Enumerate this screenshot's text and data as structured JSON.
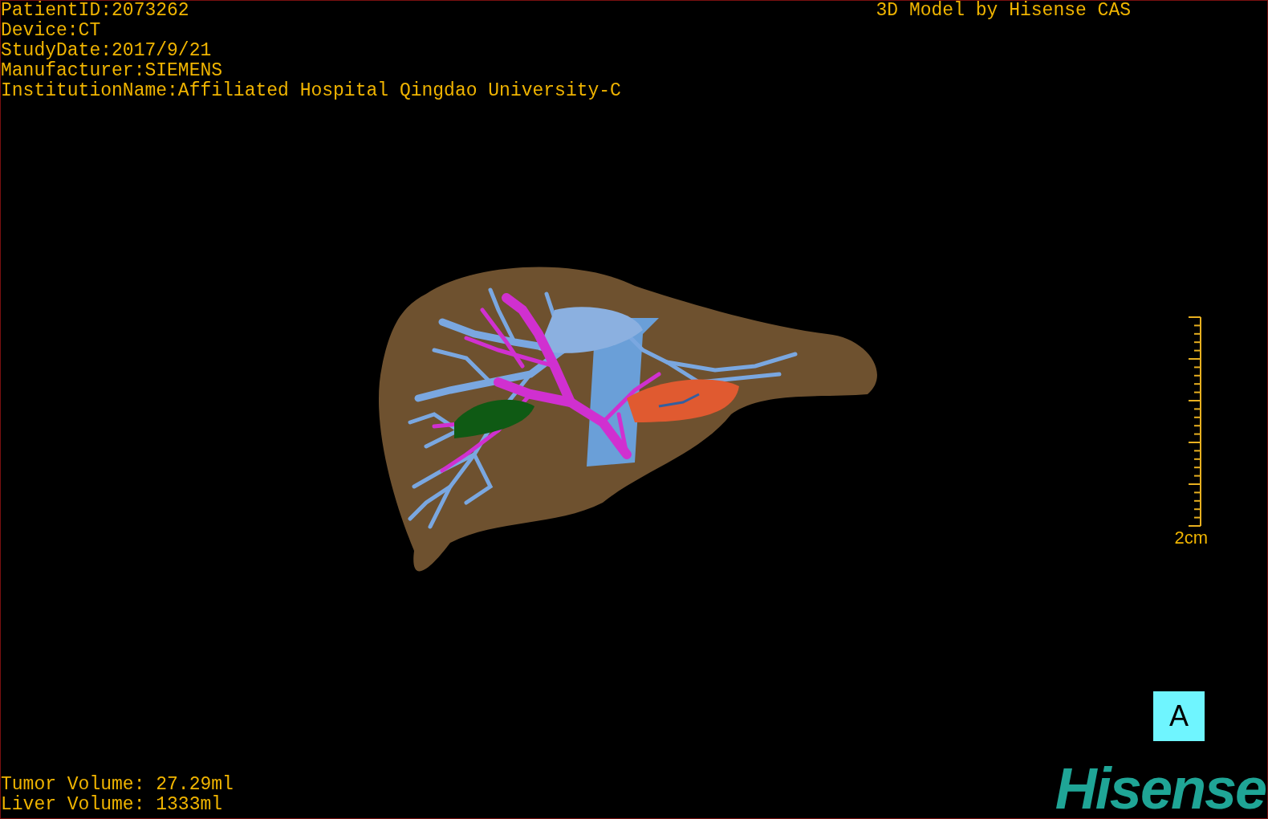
{
  "info_lines": [
    "PatientID:2073262",
    "Device:CT",
    "StudyDate:2017/9/21",
    "Manufacturer:SIEMENS",
    "InstitutionName:Affiliated Hospital Qingdao University-C"
  ],
  "title": "3D Model by Hisense CAS",
  "scale_label": "2cm",
  "view_button": "A",
  "volumes": [
    "Tumor Volume: 27.29ml",
    "Liver Volume: 1333ml"
  ],
  "logo": "Hisense"
}
